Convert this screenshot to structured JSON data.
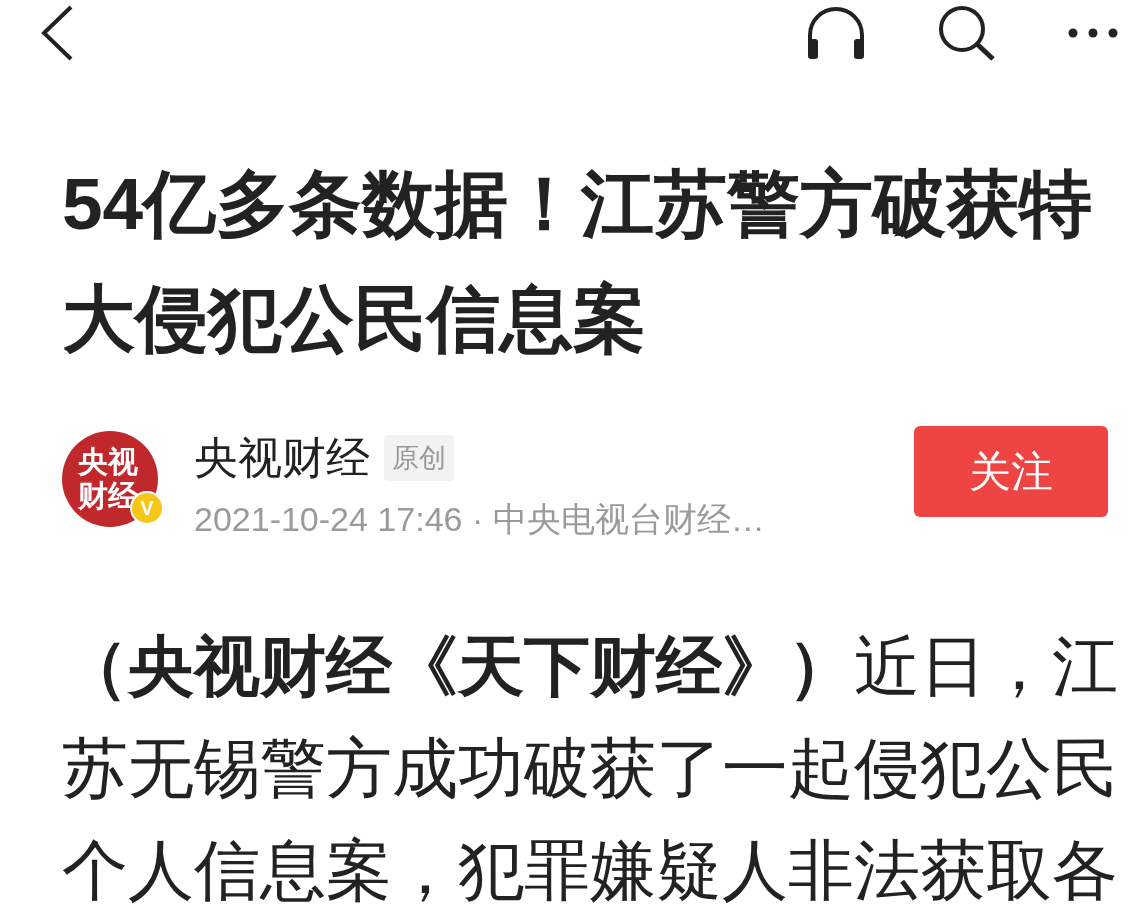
{
  "title": "54亿多条数据！江苏警方破获特大侵犯公民信息案",
  "author": {
    "avatar_text": "央视财经",
    "verified_badge": "V",
    "name": "央视财经",
    "tag": "原创",
    "meta": "2021-10-24 17:46 · 中央电视台财经…"
  },
  "follow_button": "关注",
  "body": "**（央视财经《天下财经》）**近日，江苏无锡警方成功破获了一起侵犯公民个人信息案，犯罪嫌疑人非法获取各"
}
